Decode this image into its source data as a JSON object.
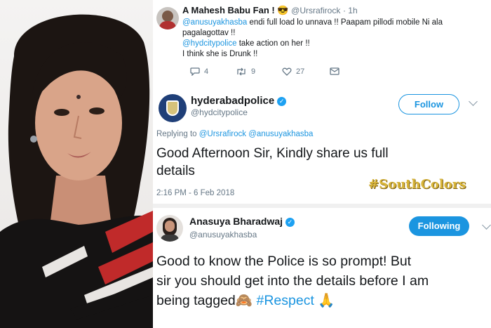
{
  "tweet1": {
    "display_name": "A Mahesh Babu Fan !",
    "emoji": "😎",
    "handle": "@Ursrafirock",
    "time": "· 1h",
    "line1_mention": "@anusuyakhasba",
    "line1_text": " endi full load lo unnava !! Paapam pillodi mobile Ni ala",
    "line2_text": "pagalagottav !!",
    "line3_mention": "@hydcitypolice",
    "line3_text": " take action on her !!",
    "line4_text": "I think she is Drunk !!",
    "replies": "4",
    "retweets": "9",
    "likes": "27"
  },
  "tweet2": {
    "display_name": "hyderabadpolice",
    "handle": "@hydcitypolice",
    "follow_label": "Follow",
    "replying_prefix": "Replying to",
    "replying_to": " @Ursrafirock @anusuyakhasba",
    "body_line1": "Good Afternoon Sir, Kindly share us full",
    "body_line2": "details",
    "timestamp": "2:16 PM - 6 Feb 2018"
  },
  "watermark": "#SouthColors",
  "tweet3": {
    "display_name": "Anasuya Bharadwaj",
    "handle": "@anusuyakhasba",
    "following_label": "Following",
    "body_line1": "Good to know the Police is so prompt! But",
    "body_line2": "sir you should get into the details before I am",
    "body_line3": "being tagged",
    "hashtag": "#Respect",
    "emoji_monkey": "🙈",
    "emoji_pray": "🙏"
  },
  "icons": {
    "reply": "reply-icon",
    "retweet": "retweet-icon",
    "like": "heart-icon",
    "dm": "message-icon",
    "verified": "verified-badge-icon",
    "caret": "chevron-down-icon"
  },
  "colors": {
    "link": "#1b95e0",
    "verified": "#1da1f2",
    "muted": "#657786",
    "watermark": "#d8b53a"
  }
}
